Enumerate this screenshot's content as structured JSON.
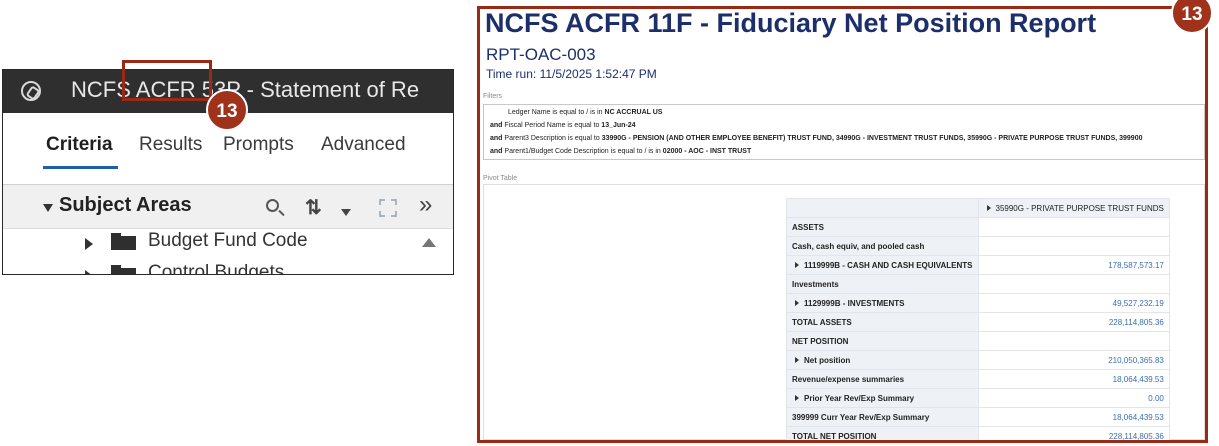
{
  "left_panel": {
    "window_title": "NCFS ACFR 53P - Statement of Re",
    "tabs": [
      {
        "label": "Criteria"
      },
      {
        "label": "Results"
      },
      {
        "label": "Prompts"
      },
      {
        "label": "Advanced"
      }
    ],
    "subject_areas": {
      "title": "Subject Areas",
      "items": [
        {
          "label": "Budget Fund Code",
          "icon": "folder-icon"
        },
        {
          "label": "Control Budgets",
          "icon": "folder-icon"
        }
      ]
    },
    "step_badge": "13"
  },
  "right_panel": {
    "title": "NCFS ACFR 11F - Fiduciary Net Position Report",
    "report_code": "RPT-OAC-003",
    "time_run": "Time run: 11/5/2025 1:52:47 PM",
    "filters_label": "Filters",
    "filters": [
      {
        "prefix": "",
        "text": "Ledger Name is equal to / is in",
        "value": "NC ACCRUAL US"
      },
      {
        "prefix": "and",
        "text": "Fiscal Period Name is equal to",
        "value": "13_Jun-24"
      },
      {
        "prefix": "and",
        "text": "Parent3 Description is equal to",
        "value": "33990G - PENSION (AND OTHER EMPLOYEE BENEFIT) TRUST FUND, 34990G - INVESTMENT TRUST FUNDS, 35990G - PRIVATE PURPOSE TRUST FUNDS, 399900"
      },
      {
        "prefix": "and",
        "text": "Parent1/Budget Code Description is equal to / is in",
        "value": "02000 - AOC - INST TRUST"
      }
    ],
    "pivot_label": "Pivot Table",
    "pivot": {
      "column_header": "35990G - PRIVATE PURPOSE TRUST FUNDS",
      "rows": [
        {
          "label": "ASSETS",
          "value": "",
          "bold": true,
          "expand": false
        },
        {
          "label": "Cash, cash equiv, and pooled cash",
          "value": "",
          "bold": true,
          "expand": false
        },
        {
          "label": "1119999B - CASH AND CASH EQUIVALENTS",
          "value": "178,587,573.17",
          "bold": true,
          "expand": true
        },
        {
          "label": "Investments",
          "value": "",
          "bold": true,
          "expand": false
        },
        {
          "label": "1129999B - INVESTMENTS",
          "value": "49,527,232.19",
          "bold": true,
          "expand": true
        },
        {
          "label": "TOTAL ASSETS",
          "value": "228,114,805.36",
          "bold": true,
          "expand": false
        },
        {
          "label": "NET POSITION",
          "value": "",
          "bold": true,
          "expand": false
        },
        {
          "label": "Net position",
          "value": "210,050,365.83",
          "bold": true,
          "expand": true
        },
        {
          "label": "Revenue/expense summaries",
          "value": "18,064,439.53",
          "bold": true,
          "expand": false
        },
        {
          "label": "Prior Year Rev/Exp Summary",
          "value": "0.00",
          "bold": true,
          "expand": true
        },
        {
          "label": "399999 Curr Year Rev/Exp Summary",
          "value": "18,064,439.53",
          "bold": true,
          "expand": false
        },
        {
          "label": "TOTAL NET POSITION",
          "value": "228,114,805.36",
          "bold": true,
          "expand": false
        }
      ]
    },
    "step_badge": "13"
  },
  "colors": {
    "highlight": "#9a2a16",
    "badge": "#a0321c",
    "title_navy": "#1c2f6b",
    "value_blue": "#3a6fb0"
  }
}
